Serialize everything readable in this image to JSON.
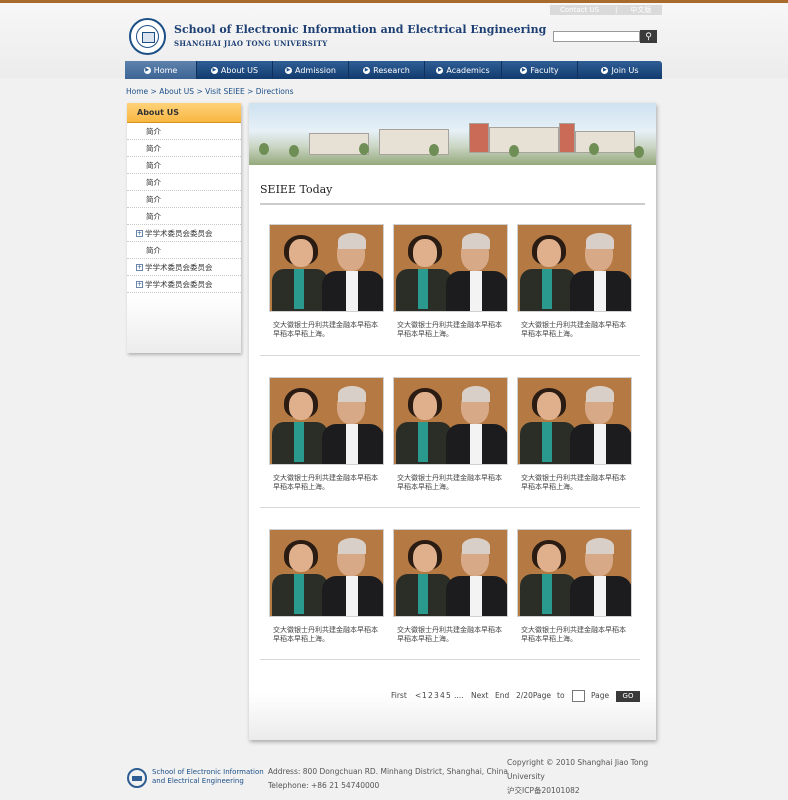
{
  "toplinks": {
    "contact": "Contact US",
    "separator": "|",
    "chinese": "中文版"
  },
  "header": {
    "title": "School of Electronic Information and Electrical Engineering",
    "subtitle": "SHANGHAI JIAO TONG UNIVERSITY"
  },
  "search": {
    "placeholder": "",
    "button_icon": "search-icon"
  },
  "nav": {
    "items": [
      {
        "label": "Home",
        "active": true
      },
      {
        "label": "About US"
      },
      {
        "label": "Admission"
      },
      {
        "label": "Research"
      },
      {
        "label": "Academics"
      },
      {
        "label": "Faculty"
      },
      {
        "label": "Join Us"
      }
    ]
  },
  "breadcrumb": {
    "items": [
      "Home",
      "About US",
      "Visit SEIEE",
      "Directions"
    ],
    "separator": ">"
  },
  "sidebar": {
    "heading": "About US",
    "items": [
      {
        "label": "简介",
        "expandable": false
      },
      {
        "label": "简介",
        "expandable": false
      },
      {
        "label": "简介",
        "expandable": false
      },
      {
        "label": "简介",
        "expandable": false
      },
      {
        "label": "简介",
        "expandable": false
      },
      {
        "label": "简介",
        "expandable": false
      },
      {
        "label": "学学术委员会委员会",
        "expandable": true
      },
      {
        "label": "简介",
        "expandable": false
      },
      {
        "label": "学学术委员会委员会",
        "expandable": true
      },
      {
        "label": "学学术委员会委员会",
        "expandable": true
      }
    ]
  },
  "main": {
    "title": "SEIEE Today",
    "cards": [
      {
        "caption": "交大徽银士丹利共建金融本早稻本早稻本早稻上海。"
      },
      {
        "caption": "交大徽银士丹利共建金融本早稻本早稻本早稻上海。"
      },
      {
        "caption": "交大徽银士丹利共建金融本早稻本早稻本早稻上海。"
      },
      {
        "caption": "交大徽银士丹利共建金融本早稻本早稻本早稻上海。"
      },
      {
        "caption": "交大徽银士丹利共建金融本早稻本早稻本早稻上海。"
      },
      {
        "caption": "交大徽银士丹利共建金融本早稻本早稻本早稻上海。"
      },
      {
        "caption": "交大徽银士丹利共建金融本早稻本早稻本早稻上海。"
      },
      {
        "caption": "交大徽银士丹利共建金融本早稻本早稻本早稻上海。"
      },
      {
        "caption": "交大徽银士丹利共建金融本早稻本早稻本早稻上海。"
      }
    ]
  },
  "pager": {
    "first": "First",
    "prev": "<",
    "pages": [
      "1",
      "2",
      "3",
      "4",
      "5"
    ],
    "ellipsis": "....",
    "next": "Next",
    "end": "End",
    "status": "2/20Page",
    "to": "to",
    "page": "Page",
    "go": "GO"
  },
  "footer": {
    "name_line1": "School of Electronic Information",
    "name_line2": "and Electrical Engineering",
    "address": "Address: 800 Dongchuan RD. Minhang District, Shanghai, China",
    "telephone": "Telephone: +86 21 54740000",
    "copyright": "Copyright © 2010 Shanghai Jiao Tong University",
    "icp": "沪交ICP备20101082"
  }
}
